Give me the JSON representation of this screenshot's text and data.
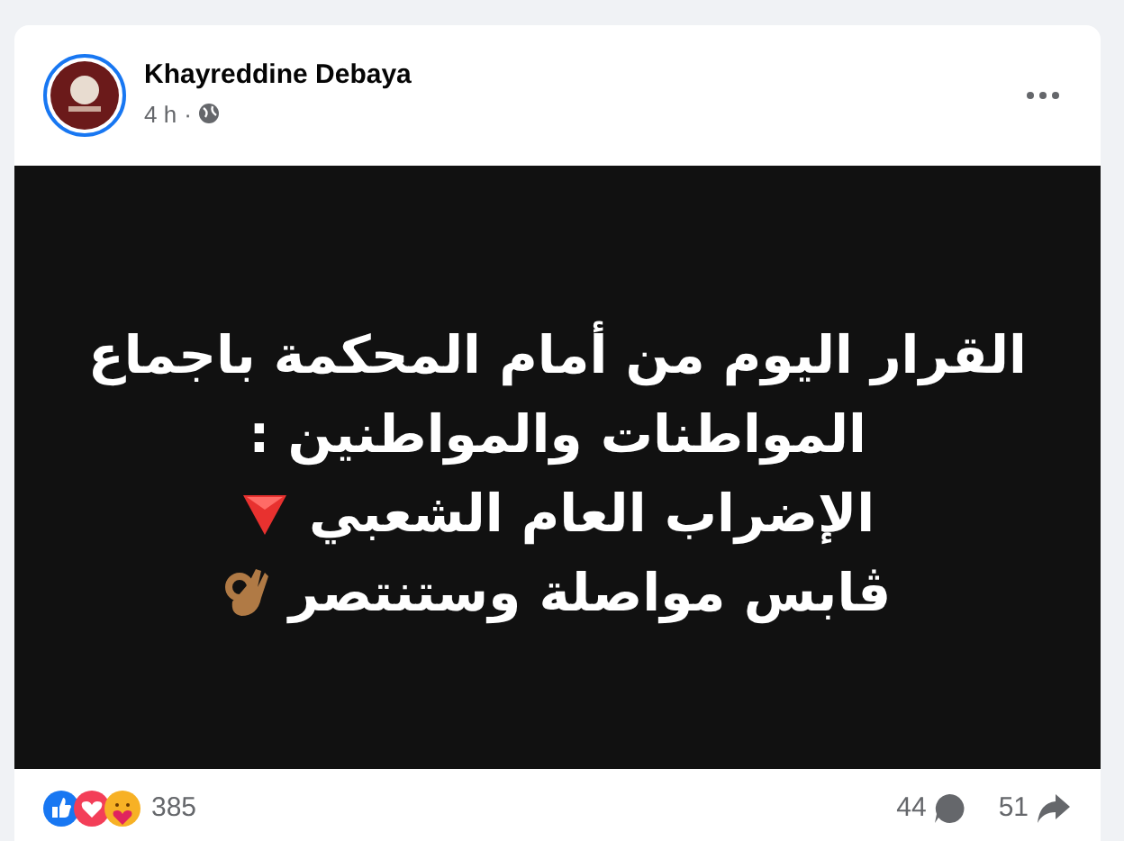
{
  "post": {
    "author": "Khayreddine Debaya",
    "time": "4 h",
    "audience_separator": "·",
    "lines": [
      {
        "text": "القرار اليوم من أمام المحكمة باجماع",
        "kind": "plain"
      },
      {
        "text": "المواطنات والمواطنين :",
        "kind": "plain"
      },
      {
        "text": "الإضراب العام الشعبي",
        "kind": "alert"
      },
      {
        "text": "ڨابس مواصلة وستنتصر",
        "kind": "ok"
      }
    ],
    "reactions": {
      "count": "385"
    },
    "comments": "44",
    "shares": "51"
  }
}
